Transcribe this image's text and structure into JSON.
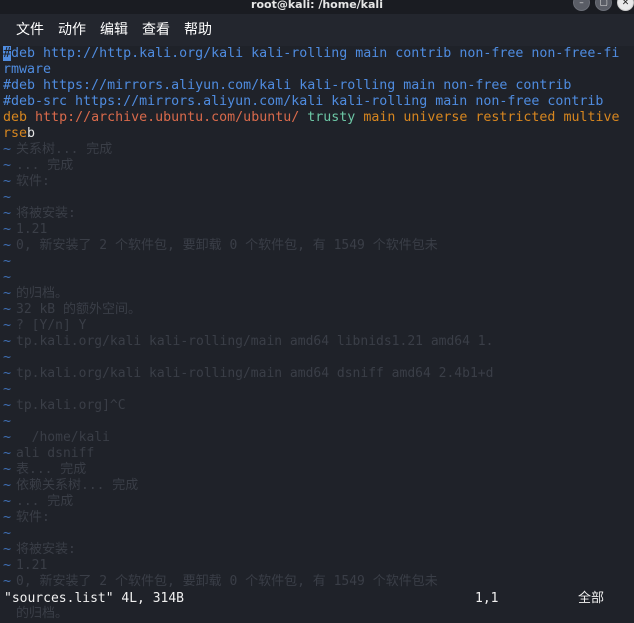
{
  "window": {
    "title": "root@kali: /home/kali",
    "minimize_glyph": "–",
    "maximize_glyph": "▢",
    "close_glyph": "✕"
  },
  "menu": {
    "items": [
      "文件",
      "动作",
      "编辑",
      "查看",
      "帮助"
    ]
  },
  "editor": {
    "cursor_char": "#",
    "line1_rest": "deb http://http.kali.org/kali kali-rolling main contrib non-free non-free-fi",
    "line1_wrap": "rmware",
    "line2": "#deb https://mirrors.aliyun.com/kali kali-rolling main non-free contrib",
    "line3": "#deb-src https://mirrors.aliyun.com/kali kali-rolling main non-free contrib",
    "line4": {
      "keyword": "deb",
      "url": "http://archive.ubuntu.com/ubuntu/",
      "suite": "trusty",
      "components": "main universe restricted multive",
      "wrap_part": "rse",
      "tail": "b"
    },
    "tilde": "~"
  },
  "ghost_text": [
    "",
    "",
    "",
    "",
    "",
    "",
    "关系树... 完成",
    "... 完成",
    "软件:",
    "",
    "将被安装:",
    "1.21",
    "0, 新安装了 2 个软件包, 要卸载 0 个软件包, 有 1549 个软件包未",
    "",
    "",
    "的归档。",
    "32 kB 的额外空间。",
    "? [Y/n] Y",
    "tp.kali.org/kali kali-rolling/main amd64 libnids1.21 amd64 1.",
    "",
    "tp.kali.org/kali kali-rolling/main amd64 dsniff amd64 2.4b1+d",
    "",
    "tp.kali.org]^C",
    "",
    "  /home/kali",
    "ali dsniff",
    "表... 完成",
    "依赖关系树... 完成",
    "... 完成",
    "软件:",
    "",
    "将被安装:",
    "1.21",
    "0, 新安装了 2 个软件包, 要卸载 0 个软件包, 有 1549 个软件包未",
    "",
    "的归档。",
    ""
  ],
  "status": {
    "file": "\"sources.list\" 4L, 314B",
    "position": "1,1",
    "mode": "全部"
  }
}
